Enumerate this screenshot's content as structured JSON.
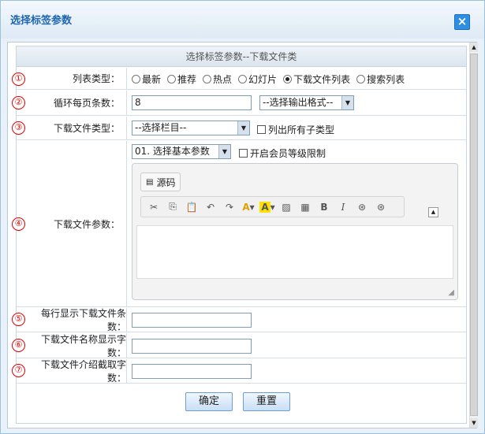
{
  "dialog": {
    "title": "选择标签参数",
    "close_glyph": "×"
  },
  "form": {
    "header": "选择标签参数--下载文件类",
    "markers": [
      "①",
      "②",
      "③",
      "④",
      "⑤",
      "⑥",
      "⑦"
    ],
    "list_type": {
      "label": "列表类型：",
      "options": [
        "最新",
        "推荐",
        "热点",
        "幻灯片",
        "下载文件列表",
        "搜索列表"
      ],
      "selected_index": 4
    },
    "per_page": {
      "label": "循环每页条数：",
      "value": "8",
      "format_select": "--选择输出格式--"
    },
    "file_type": {
      "label": "下载文件类型：",
      "select": "--选择栏目--",
      "checkbox": "列出所有子类型"
    },
    "file_params": {
      "label": "下载文件参数：",
      "select": "01. 选择基本参数",
      "checkbox": "开启会员等级限制",
      "editor": {
        "source_button": "源码",
        "tools": [
          "cut-icon",
          "copy-icon",
          "paste-icon",
          "undo-icon",
          "redo-icon",
          "font-color-icon",
          "highlight-icon",
          "image-icon",
          "table-icon",
          "bold-icon",
          "italic-icon",
          "link-icon",
          "unlink-icon"
        ],
        "bold_glyph": "B",
        "italic_glyph": "I",
        "highlight_glyph": "A",
        "fontcolor_glyph": "A"
      }
    },
    "per_row": {
      "label": "每行显示下载文件条数："
    },
    "name_chars": {
      "label": "下载文件名称显示字数："
    },
    "intro_chars": {
      "label": "下载文件介绍截取字数："
    },
    "buttons": {
      "confirm": "确定",
      "reset": "重置"
    }
  },
  "colors": {
    "title": "#1d66b0",
    "marker": "#dd0000",
    "close": "#2f8ee0"
  }
}
